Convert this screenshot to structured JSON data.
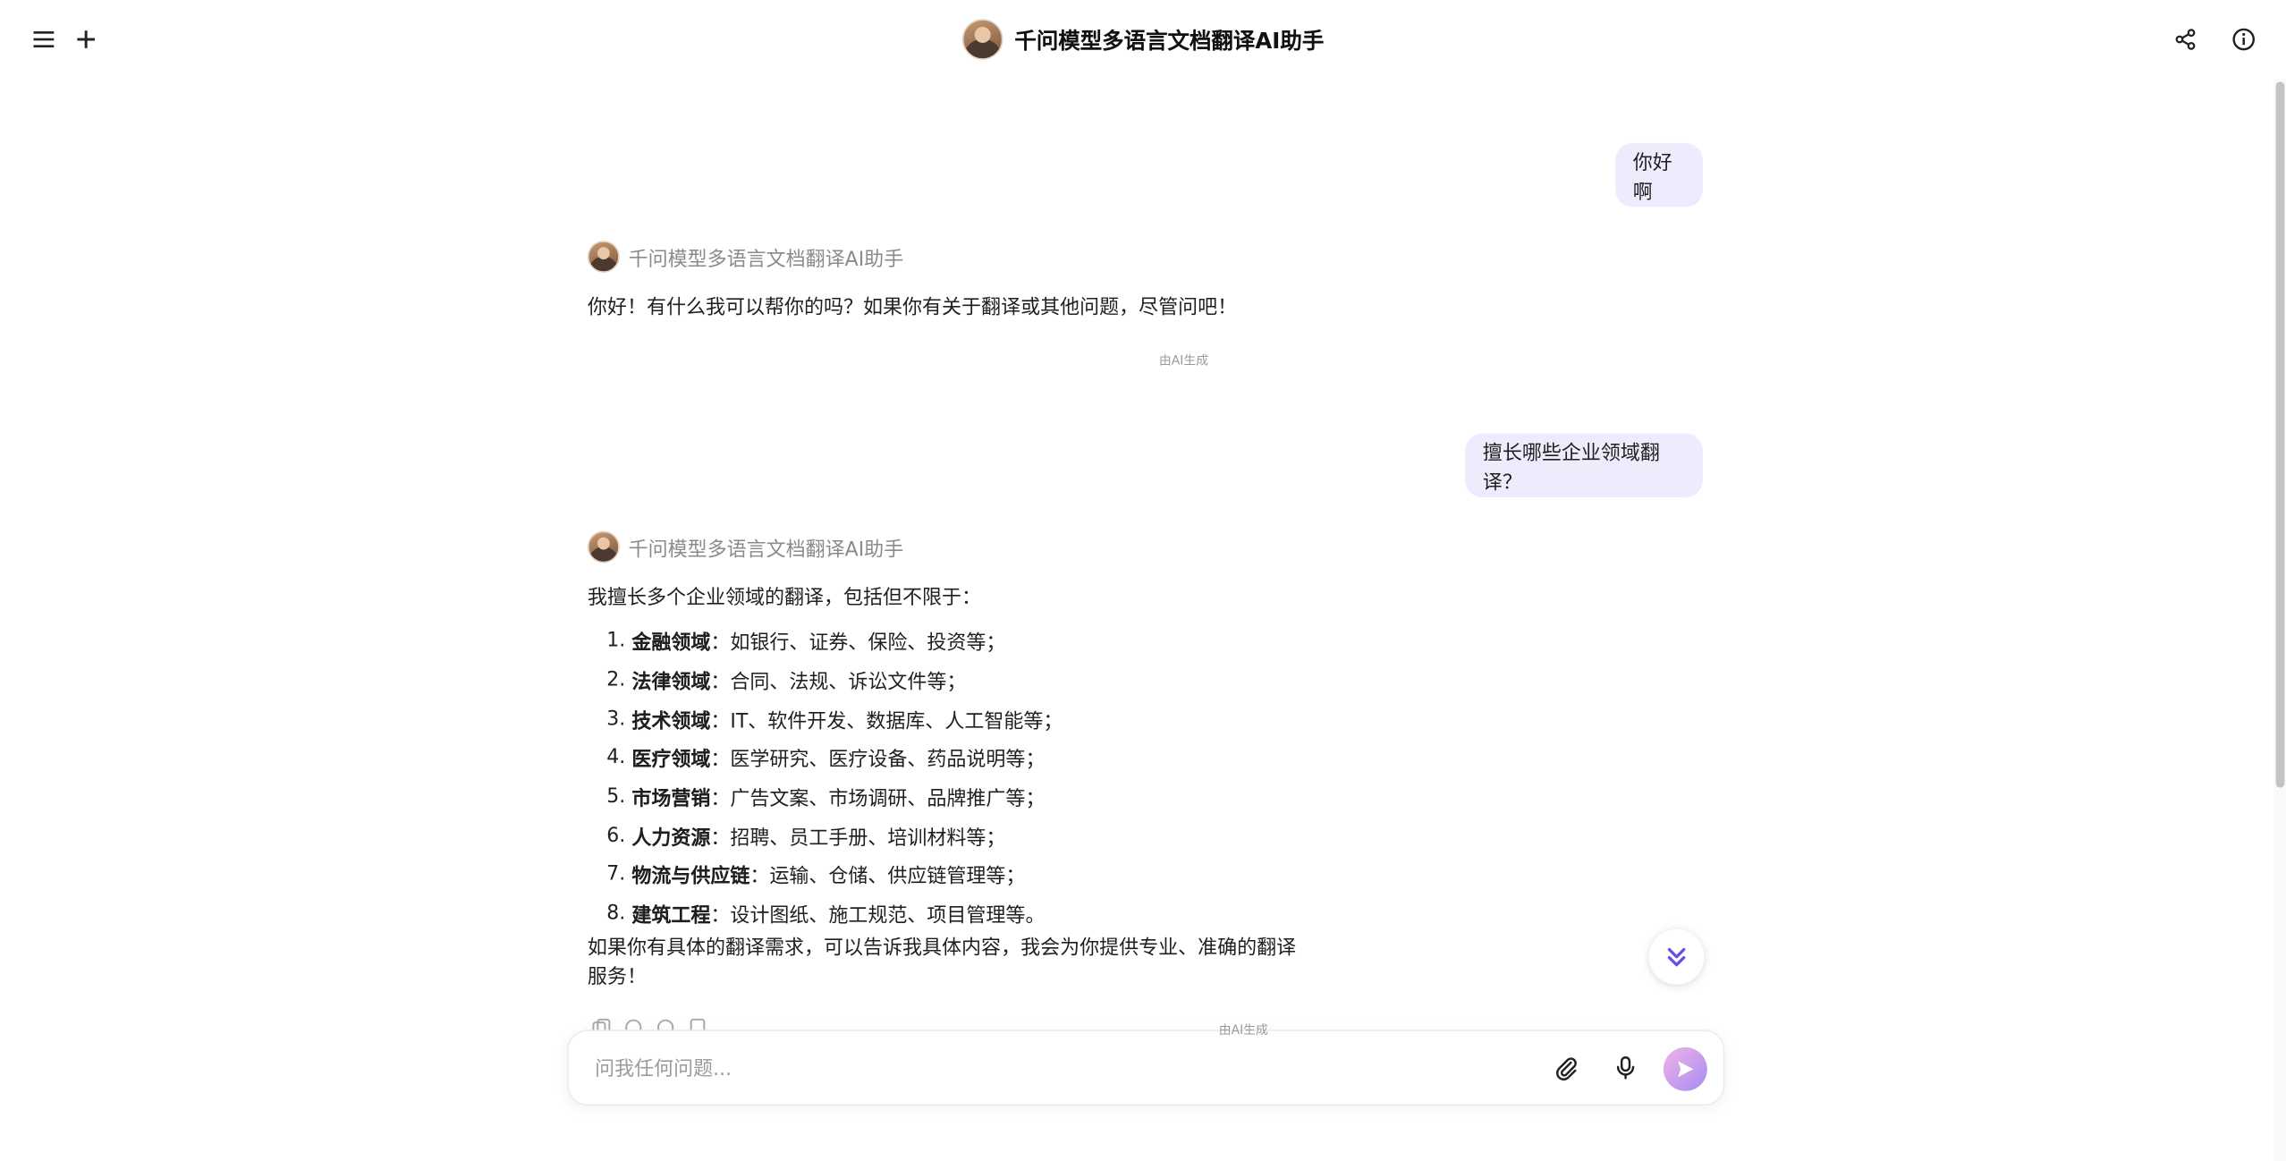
{
  "header": {
    "title": "千问模型多语言文档翻译AI助手"
  },
  "conversation": {
    "bot_name": "千问模型多语言文档翻译AI助手",
    "ai_generated_label": "由AI生成",
    "messages": [
      {
        "role": "user",
        "text": "你好啊"
      },
      {
        "role": "assistant",
        "text": "你好！有什么我可以帮你的吗？如果你有关于翻译或其他问题，尽管问吧！"
      },
      {
        "role": "user",
        "text": "擅长哪些企业领域翻译？"
      },
      {
        "role": "assistant",
        "intro": "我擅长多个企业领域的翻译，包括但不限于：",
        "items": [
          {
            "num": "1.",
            "term": "金融领域",
            "desc": "：如银行、证券、保险、投资等；"
          },
          {
            "num": "2.",
            "term": "法律领域",
            "desc": "：合同、法规、诉讼文件等；"
          },
          {
            "num": "3.",
            "term": "技术领域",
            "desc": "：IT、软件开发、数据库、人工智能等；"
          },
          {
            "num": "4.",
            "term": "医疗领域",
            "desc": "：医学研究、医疗设备、药品说明等；"
          },
          {
            "num": "5.",
            "term": "市场营销",
            "desc": "：广告文案、市场调研、品牌推广等；"
          },
          {
            "num": "6.",
            "term": "人力资源",
            "desc": "：招聘、员工手册、培训材料等；"
          },
          {
            "num": "7.",
            "term": "物流与供应链",
            "desc": "：运输、仓储、供应链管理等；"
          },
          {
            "num": "8.",
            "term": "建筑工程",
            "desc": "：设计图纸、施工规范、项目管理等。"
          }
        ],
        "outro_line1": "如果你有具体的翻译需求，可以告诉我具体内容，我会为你提供专业、准确的翻译",
        "outro_line2": "服务！"
      }
    ]
  },
  "composer": {
    "placeholder": "问我任何问题..."
  },
  "icons": {
    "menu": "menu-icon",
    "new_chat": "plus-icon",
    "share": "share-icon",
    "info": "info-icon",
    "attach": "paperclip-icon",
    "mic": "microphone-icon",
    "send": "send-icon",
    "scroll_down": "double-chevron-down-icon"
  },
  "colors": {
    "user_bubble": "#efebfd",
    "accent": "#7b5cf0"
  }
}
